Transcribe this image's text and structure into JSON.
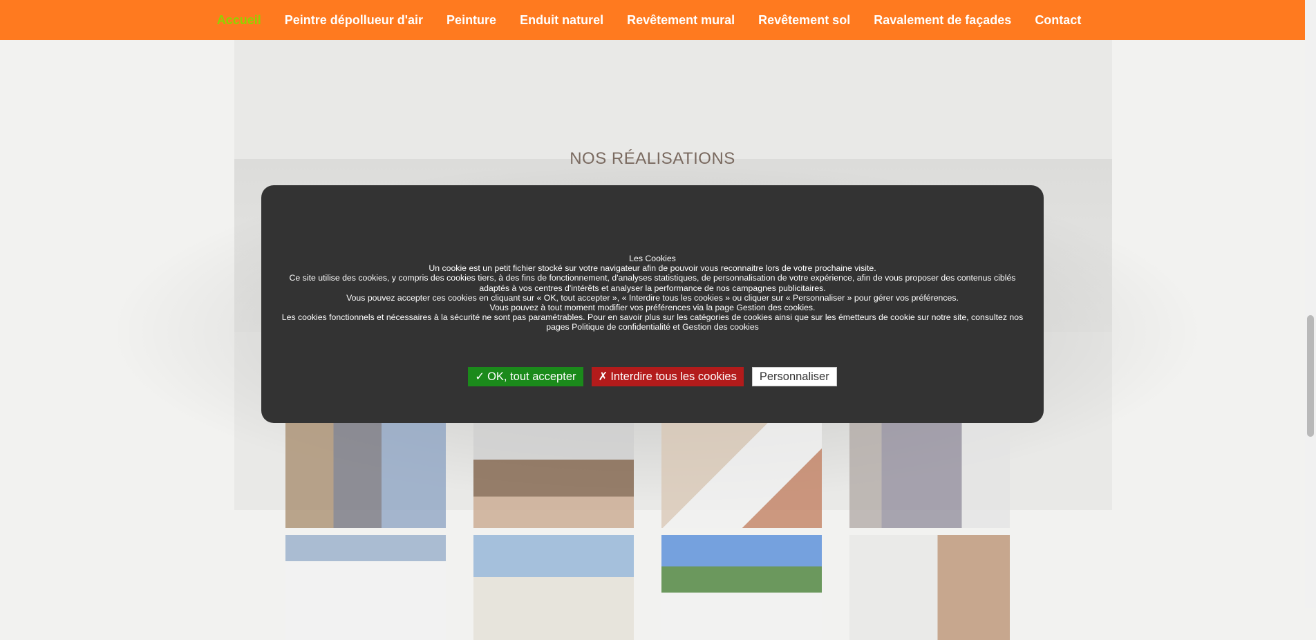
{
  "nav": {
    "items": [
      {
        "label": "Accueil",
        "active": true
      },
      {
        "label": "Peintre dépollueur d'air"
      },
      {
        "label": "Peinture"
      },
      {
        "label": "Enduit naturel"
      },
      {
        "label": "Revêtement mural"
      },
      {
        "label": "Revêtement sol"
      },
      {
        "label": "Ravalement de façades"
      },
      {
        "label": "Contact"
      }
    ],
    "bg_color": "#ff7a1f",
    "active_color": "#8fd400"
  },
  "section": {
    "title": "NOS RÉALISATIONS"
  },
  "cookie": {
    "title": "Les Cookies",
    "lines": [
      "Un cookie est un petit fichier stocké sur votre navigateur afin de pouvoir vous reconnaitre lors de votre prochaine visite.",
      "Ce site utilise des cookies, y compris des cookies tiers, à des fins de fonctionnement, d'analyses statistiques, de personnalisation de votre expérience, afin de vous proposer des contenus ciblés adaptés à vos centres d'intérêts et analyser la performance de nos campagnes publicitaires.",
      "Vous pouvez accepter ces cookies en cliquant sur « OK, tout accepter », «  Interdire tous les cookies  » ou cliquer sur « Personnaliser » pour gérer vos préférences.",
      "Vous pouvez à tout moment modifier vos préférences via la page Gestion des cookies.",
      "Les cookies fonctionnels et nécessaires à la sécurité ne sont pas paramétrables. Pour en savoir plus sur les catégories de cookies ainsi que sur les émetteurs de cookie sur notre site, consultez nos pages Politique de confidentialité et Gestion des cookies"
    ],
    "buttons": {
      "accept_icon": "✓",
      "accept": "OK, tout accepter",
      "deny_icon": "✗",
      "deny": "Interdire tous les cookies",
      "customize": "Personnaliser"
    }
  }
}
